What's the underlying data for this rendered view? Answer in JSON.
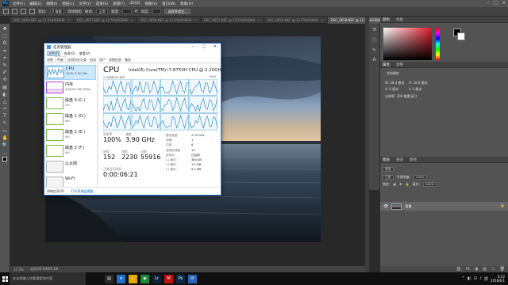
{
  "photoshop": {
    "logo": "Ps",
    "menu": [
      "文件(F)",
      "编辑(E)",
      "图像(I)",
      "图层(L)",
      "文字(Y)",
      "选择(S)",
      "滤镜(T)",
      "3D(D)",
      "视图(V)",
      "窗口(W)",
      "帮助(H)"
    ],
    "window_controls": [
      "–",
      "□",
      "✕"
    ],
    "options": {
      "feather_label": "羽化:",
      "feather_value": "0 像素",
      "antialias_label": "消除锯齿",
      "style_label": "样式:",
      "style_value": "正常",
      "width_label": "宽度:",
      "height_label": "高度:",
      "select_mask_button": "选择并遮住..."
    },
    "doc_tabs": [
      {
        "label": "DSC_0654.NEF @ 12.5%(RGB/8)",
        "active": false
      },
      {
        "label": "DSC_0657.NEF @ 12.5%(RGB/8)",
        "active": false
      },
      {
        "label": "DSC_0658.NEF @ 12.5%(RGB/8)",
        "active": false
      },
      {
        "label": "DSC_0657.NEF @ 12.5%(RGB/8)",
        "active": false
      },
      {
        "label": "DSC_0656.NEF @ 12.5%(RGB/8)",
        "active": false
      },
      {
        "label": "DSC_0658.NEF @ 12.5%(RGB/8)",
        "active": true
      }
    ],
    "tab_close": "×",
    "tools": [
      "✥",
      "⬚",
      "ʘ",
      "⌗",
      "⌖",
      "✎",
      "✐",
      "⟲",
      "▤",
      "◐",
      "△",
      "✑",
      "T",
      "↖",
      "▭",
      "✋",
      "🔍",
      "…"
    ],
    "status": {
      "zoom": "12.5%",
      "doc_info": "文档:69.1M/69.1M"
    },
    "panels": {
      "color_tabs": [
        "颜色",
        "色板"
      ],
      "properties_tabs": [
        "属性",
        "调整"
      ],
      "properties_lines": [
        "文档属性",
        "W: 28.4 厘米",
        "H: 18.9 厘米",
        "X: 0 厘米",
        "Y: 0 厘米",
        "分辨率: 300 像素/英寸"
      ],
      "layers_tabs": [
        "图层",
        "通道",
        "路径"
      ],
      "layer_kind": "类型",
      "blend_mode": "正常",
      "opacity_label": "不透明度:",
      "opacity_value": "100%",
      "lock_label": "锁定:",
      "fill_label": "填充:",
      "fill_value": "100%",
      "layer_name": "背景",
      "footer_icons": [
        "⛓",
        "fx",
        "◑",
        "▥",
        "▭",
        "🗑"
      ],
      "colors": {
        "picked": "#e31b2c",
        "foreground": "#000000",
        "background": "#ffffff"
      }
    }
  },
  "taskmgr": {
    "title": "任务管理器",
    "controls": [
      "–",
      "□",
      "✕"
    ],
    "menu": [
      "文件(F)",
      "选项(O)",
      "查看(V)"
    ],
    "tabs": [
      "进程",
      "性能",
      "应用历史记录",
      "启动",
      "用户",
      "详细信息",
      "服务"
    ],
    "active_tab": "性能",
    "sidebar": [
      {
        "name": "CPU",
        "detail": "100% 3.90 GHz",
        "kind": "cpu",
        "selected": true
      },
      {
        "name": "内存",
        "detail": "4.8/15.9 GB (30%)",
        "kind": "mem",
        "selected": false
      },
      {
        "name": "磁盘 0 (C:)",
        "detail": "2%",
        "kind": "disk",
        "selected": false
      },
      {
        "name": "磁盘 1 (D:)",
        "detail": "0%",
        "kind": "disk",
        "selected": false
      },
      {
        "name": "磁盘 2 (E:)",
        "detail": "0%",
        "kind": "disk",
        "selected": false
      },
      {
        "name": "磁盘 3 (F:)",
        "detail": "0%",
        "kind": "disk",
        "selected": false
      },
      {
        "name": "以太网",
        "detail": "",
        "kind": "net",
        "selected": false
      },
      {
        "name": "Wi-Fi",
        "detail": "",
        "kind": "net",
        "selected": false
      }
    ],
    "cpu": {
      "label": "CPU",
      "model": "Intel(R) Core(TM) i7-8750H CPU @ 2.20GHz",
      "util_label": "% 利用率 60 秒内",
      "util_max": "100%",
      "stats_labels": [
        "利用率",
        "速度",
        "进程",
        "线程",
        "句柄",
        "正常运行时间"
      ],
      "stats_values": [
        "100%",
        "3.90 GHz",
        "152",
        "2230",
        "55916",
        "0:00:06:21"
      ],
      "spec_labels": [
        "基准速度:",
        "插槽:",
        "内核:",
        "逻辑处理器:",
        "虚拟化:",
        "L1 缓存:",
        "L2 缓存:",
        "L3 缓存:"
      ],
      "spec_values": [
        "2.20 GHz",
        "1",
        "6",
        "12",
        "已启用",
        "384 KB",
        "1.5 MB",
        "9.0 MB"
      ]
    },
    "footer": [
      "简略信息(D)",
      "打开资源监视器"
    ]
  },
  "taskbar": {
    "search_placeholder": "在这里输入你要搜索的内容",
    "apps": [
      {
        "icon": "▤",
        "color": "#2b2b2b"
      },
      {
        "icon": "e",
        "color": "#1f6fd0"
      },
      {
        "icon": "▭",
        "color": "#e0a800"
      },
      {
        "icon": "◉",
        "color": "#1a8a3a"
      },
      {
        "icon": "Lr",
        "color": "#0e2238"
      },
      {
        "icon": "M",
        "color": "#c01010"
      },
      {
        "icon": "Ps",
        "color": "#0b2a45"
      },
      {
        "icon": "✉",
        "color": "#2b64b8"
      }
    ],
    "tray_icons": [
      "^",
      "◧",
      "⊡",
      "♪",
      "拼"
    ],
    "time": "6:52",
    "date": "2018/6/1"
  }
}
